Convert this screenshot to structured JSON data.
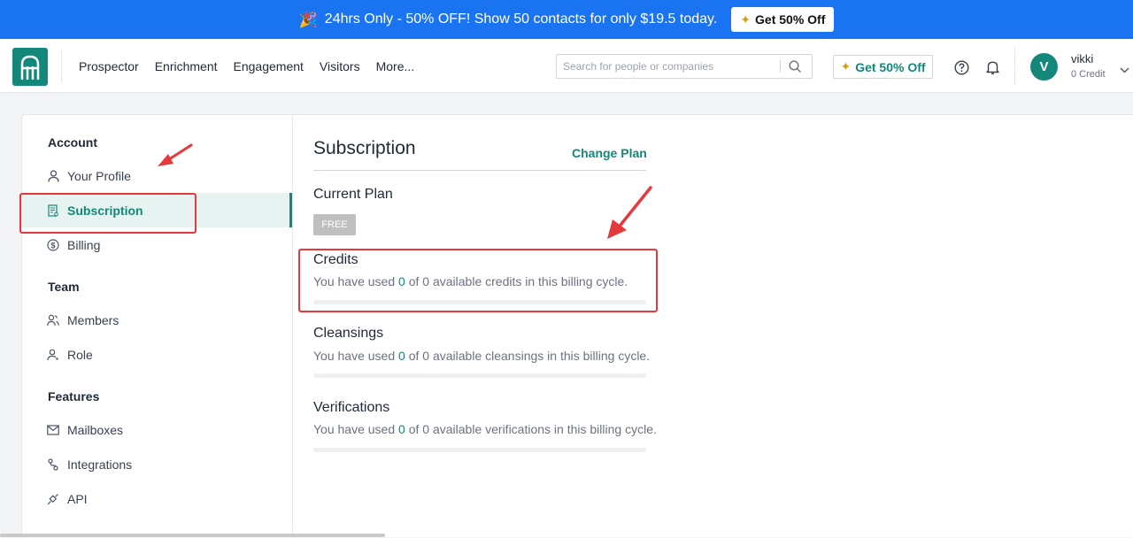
{
  "promo": {
    "text": "24hrs Only - 50% OFF! Show 50 contacts for only $19.5 today.",
    "button_label": "Get 50% Off",
    "icon": "party-popper-icon"
  },
  "nav": {
    "links": [
      "Prospector",
      "Enrichment",
      "Engagement",
      "Visitors",
      "More..."
    ],
    "search_placeholder": "Search for people or companies",
    "upsell_label": "Get 50% Off",
    "user": {
      "initial": "V",
      "name": "vikki",
      "credit": "0 Credit"
    }
  },
  "sidebar": {
    "sections": [
      {
        "title": "Account",
        "items": [
          {
            "label": "Your Profile",
            "icon": "user-icon"
          },
          {
            "label": "Subscription",
            "icon": "receipt-icon",
            "active": true
          },
          {
            "label": "Billing",
            "icon": "dollar-icon"
          }
        ]
      },
      {
        "title": "Team",
        "items": [
          {
            "label": "Members",
            "icon": "users-icon"
          },
          {
            "label": "Role",
            "icon": "role-icon"
          }
        ]
      },
      {
        "title": "Features",
        "items": [
          {
            "label": "Mailboxes",
            "icon": "mail-icon"
          },
          {
            "label": "Integrations",
            "icon": "link-icon"
          },
          {
            "label": "API",
            "icon": "plug-icon"
          }
        ]
      }
    ]
  },
  "main": {
    "title": "Subscription",
    "change_plan": "Change Plan",
    "current_plan_label": "Current Plan",
    "plan_badge": "FREE",
    "usage_prefix": "You have used",
    "usage_of": "of",
    "credits": {
      "title": "Credits",
      "used": "0",
      "total": "0",
      "suffix": "available credits in this billing cycle.",
      "fraction": 0
    },
    "cleansings": {
      "title": "Cleansings",
      "used": "0",
      "total": "0",
      "suffix": "available cleansings in this billing cycle.",
      "fraction": 0
    },
    "verifications": {
      "title": "Verifications",
      "used": "0",
      "total": "0",
      "suffix": "available verifications in this billing cycle.",
      "fraction": 0
    }
  },
  "colors": {
    "brand": "#13887a",
    "promo_bg": "#1a73f0",
    "annotation": "#e5393d"
  }
}
